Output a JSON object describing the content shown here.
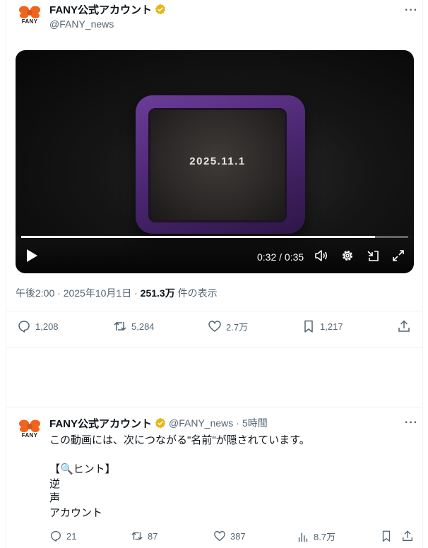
{
  "account": {
    "display_name": "FANY公式アカウント",
    "handle": "@FANY_news",
    "avatar_text": "FANY",
    "verified": true
  },
  "main_tweet": {
    "video": {
      "overlay_text": "2025.11.1",
      "time_display": "0:32 / 0:35",
      "progress": 0.914
    },
    "meta": {
      "time": "午後2:00",
      "date": "2025年10月1日",
      "views_value": "251.3万",
      "views_suffix": "件の表示",
      "sep": "·"
    },
    "actions": {
      "replies": "1,208",
      "retweets": "5,284",
      "likes": "2.7万",
      "bookmarks": "1,217"
    }
  },
  "reply_tweet": {
    "time_ago": "5時間",
    "sep": "·",
    "lines": [
      "この動画には、次につながる\"名前\"が隠されています。",
      "",
      "【🔍ヒント】",
      "逆",
      "声",
      "アカウント"
    ],
    "actions": {
      "replies": "21",
      "retweets": "87",
      "likes": "387",
      "views": "8.7万"
    }
  },
  "more_label": "···",
  "colors": {
    "accent_gold": "#e2b719",
    "brand_orange": "#f0641e",
    "muted": "#536471",
    "tv_purple": "#5b2f86"
  }
}
